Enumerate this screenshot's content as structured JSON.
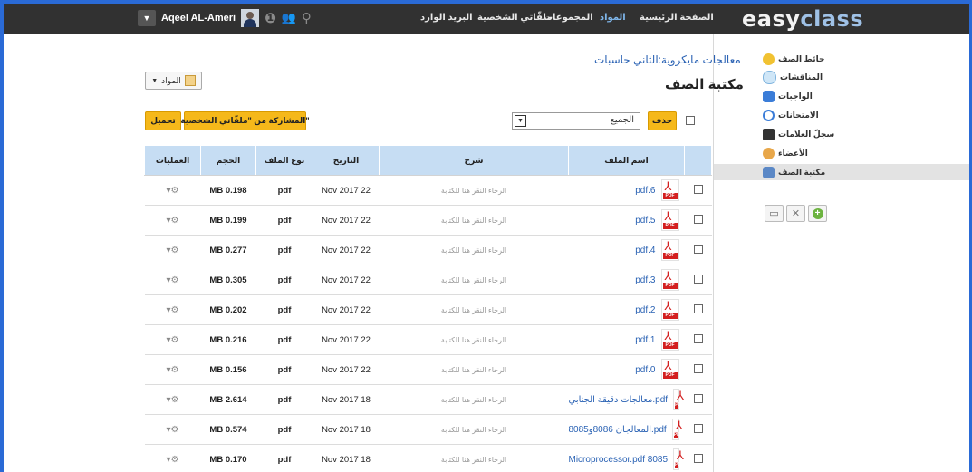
{
  "header": {
    "brand_part1": "easy",
    "brand_part2": "class",
    "nav": [
      "الصفحة الرئيسية",
      "المواد",
      "المجموعات",
      "ملفّاتي الشخصية",
      "البريد الوارد"
    ],
    "user_name": "Aqeel AL-Ameri"
  },
  "sidebar": {
    "items": [
      "حائط الصف",
      "المناقشات",
      "الواجبات",
      "الامتحانات",
      "سجلّ العلامات",
      "الأعضاء",
      "مكتبة الصف"
    ]
  },
  "main": {
    "folder_title": "معالجات مايكروية:الثاني حاسبات",
    "page_title": "مكتبة الصف",
    "mawad_button": "المواد",
    "delete_button": "حذف",
    "filter_value": "الجميع",
    "share_button": "المشاركة من \"ملفّاتي الشخصية\"",
    "download_button": "تحميل"
  },
  "table": {
    "headers": [
      "اسم الملف",
      "شرح",
      "التاريخ",
      "نوع الملف",
      "الحجم",
      "العمليات"
    ],
    "rows": [
      {
        "name": "pdf.6",
        "desc": "الرجاء النقر هنا للكتابة",
        "date": "Nov 2017 22",
        "type": "pdf",
        "size": "MB 0.198"
      },
      {
        "name": "pdf.5",
        "desc": "الرجاء النقر هنا للكتابة",
        "date": "Nov 2017 22",
        "type": "pdf",
        "size": "MB 0.199"
      },
      {
        "name": "pdf.4",
        "desc": "الرجاء النقر هنا للكتابة",
        "date": "Nov 2017 22",
        "type": "pdf",
        "size": "MB 0.277"
      },
      {
        "name": "pdf.3",
        "desc": "الرجاء النقر هنا للكتابة",
        "date": "Nov 2017 22",
        "type": "pdf",
        "size": "MB 0.305"
      },
      {
        "name": "pdf.2",
        "desc": "الرجاء النقر هنا للكتابة",
        "date": "Nov 2017 22",
        "type": "pdf",
        "size": "MB 0.202"
      },
      {
        "name": "pdf.1",
        "desc": "الرجاء النقر هنا للكتابة",
        "date": "Nov 2017 22",
        "type": "pdf",
        "size": "MB 0.216"
      },
      {
        "name": "pdf.0",
        "desc": "الرجاء النقر هنا للكتابة",
        "date": "Nov 2017 22",
        "type": "pdf",
        "size": "MB 0.156"
      },
      {
        "name": "معالجات دقيقة الجنابي.pdf",
        "desc": "الرجاء النقر هنا للكتابة",
        "date": "Nov 2017 18",
        "type": "pdf",
        "size": "MB 2.614"
      },
      {
        "name": "المعالجان 8086و8085.pdf",
        "desc": "الرجاء النقر هنا للكتابة",
        "date": "Nov 2017 18",
        "type": "pdf",
        "size": "MB 0.574"
      },
      {
        "name": "Microprocessor.pdf 8085",
        "desc": "الرجاء النقر هنا للكتابة",
        "date": "Nov 2017 18",
        "type": "pdf",
        "size": "MB 0.170"
      }
    ]
  }
}
